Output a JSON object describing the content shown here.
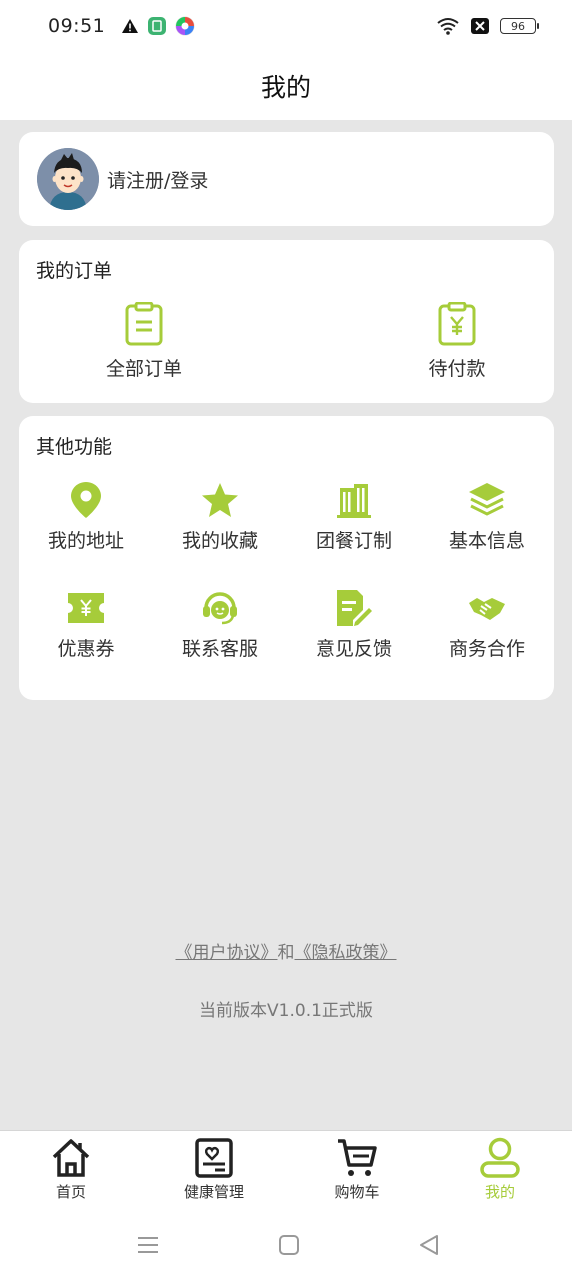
{
  "status_bar": {
    "time": "09:51",
    "battery": "96"
  },
  "header": {
    "title": "我的"
  },
  "login": {
    "text": "请注册/登录"
  },
  "orders": {
    "title": "我的订单",
    "items": [
      {
        "label": "全部订单",
        "icon": "clipboard-list-icon"
      },
      {
        "label": "待付款",
        "icon": "clipboard-yen-icon"
      }
    ]
  },
  "functions": {
    "title": "其他功能",
    "items": [
      {
        "label": "我的地址",
        "icon": "location-pin-icon"
      },
      {
        "label": "我的收藏",
        "icon": "star-icon"
      },
      {
        "label": "团餐订制",
        "icon": "building-icon"
      },
      {
        "label": "基本信息",
        "icon": "layers-icon"
      },
      {
        "label": "优惠券",
        "icon": "coupon-icon"
      },
      {
        "label": "联系客服",
        "icon": "headset-icon"
      },
      {
        "label": "意见反馈",
        "icon": "feedback-edit-icon"
      },
      {
        "label": "商务合作",
        "icon": "handshake-icon"
      }
    ]
  },
  "footer": {
    "agreement": "《用户协议》",
    "and": "和",
    "privacy": "《隐私政策》",
    "version": "当前版本V1.0.1正式版"
  },
  "tabbar": {
    "items": [
      {
        "label": "首页",
        "icon": "home-icon"
      },
      {
        "label": "健康管理",
        "icon": "health-report-icon"
      },
      {
        "label": "购物车",
        "icon": "cart-icon"
      },
      {
        "label": "我的",
        "icon": "user-icon"
      }
    ],
    "active_index": 3
  },
  "colors": {
    "accent": "#a6cc3a",
    "background": "#e6e6e6",
    "card": "#ffffff"
  }
}
